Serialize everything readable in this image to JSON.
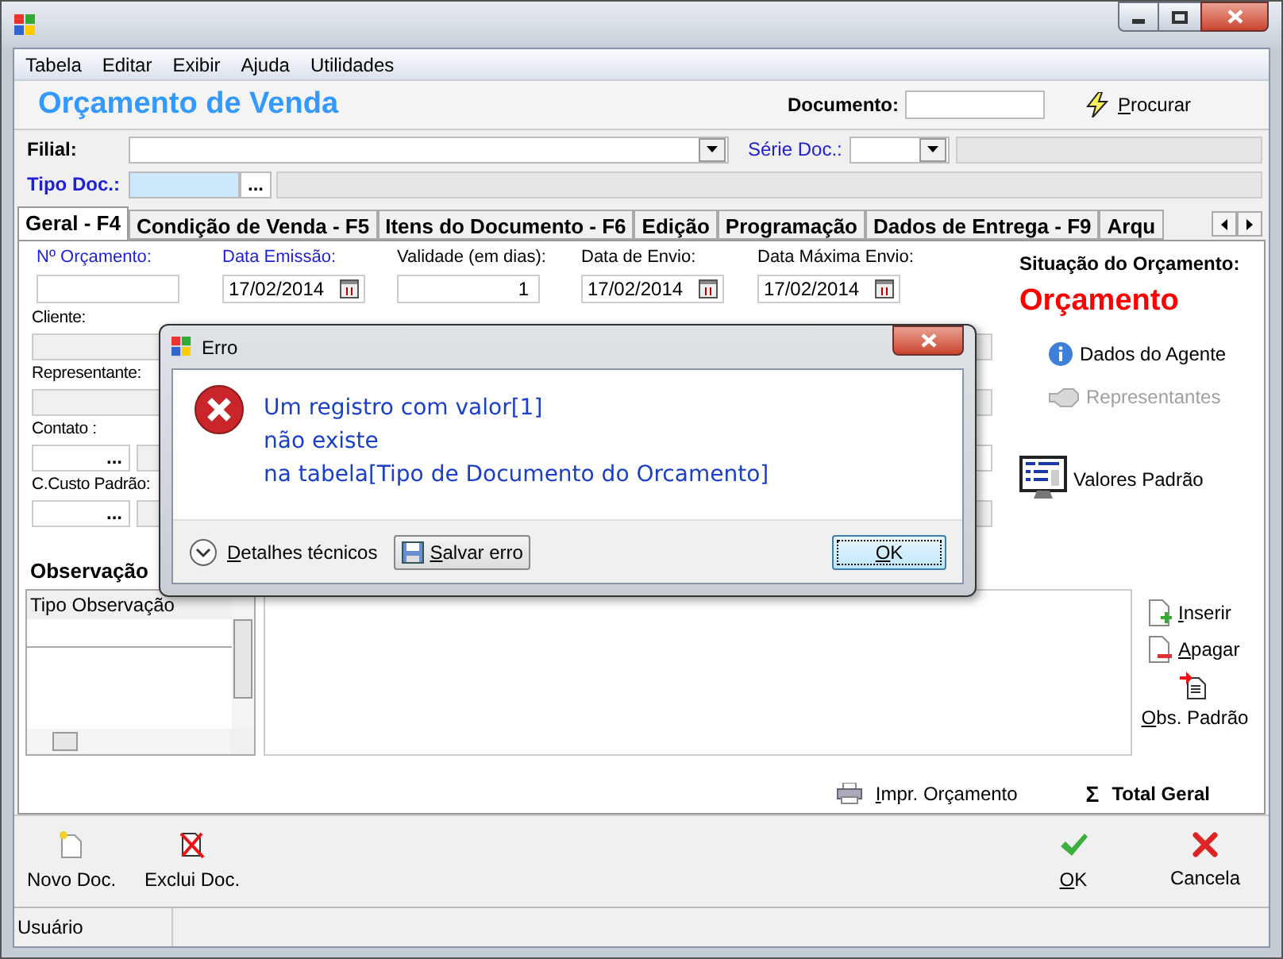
{
  "menu": [
    "Tabela",
    "Editar",
    "Exibir",
    "Ajuda",
    "Utilidades"
  ],
  "header": {
    "title": "Orçamento de Venda",
    "document_label": "Documento:",
    "search_button": "Procurar"
  },
  "filial": {
    "label": "Filial:"
  },
  "serie": {
    "label": "Série Doc.:"
  },
  "tipo_doc": {
    "label": "Tipo Doc.:",
    "lookup": "..."
  },
  "tabs": [
    {
      "label": "Geral - F4",
      "selected": true
    },
    {
      "label": "Condição de Venda - F5",
      "selected": false
    },
    {
      "label": "Itens do Documento - F6",
      "selected": false
    },
    {
      "label": "Edição",
      "selected": false
    },
    {
      "label": "Programação",
      "selected": false
    },
    {
      "label": "Dados de Entrega - F9",
      "selected": false
    },
    {
      "label": "Arqu",
      "selected": false
    }
  ],
  "top_fields": [
    {
      "label": "Nº Orçamento:",
      "required": true,
      "kind": "text"
    },
    {
      "label": "Data Emissão:",
      "required": true,
      "kind": "date",
      "value": "17/02/2014"
    },
    {
      "label": "Validade (em dias):",
      "required": false,
      "kind": "number",
      "value": "1"
    },
    {
      "label": "Data de Envio:",
      "required": false,
      "kind": "date",
      "value": "17/02/2014"
    },
    {
      "label": "Data Máxima Envio:",
      "required": false,
      "kind": "date",
      "value": "17/02/2014"
    }
  ],
  "left_fields": [
    {
      "label": "Cliente:",
      "kind": "plain"
    },
    {
      "label": "Representante:",
      "kind": "plain"
    },
    {
      "label": "Contato :",
      "kind": "lookup",
      "lookup": "..."
    },
    {
      "label": "C.Custo Padrão:",
      "kind": "lookup",
      "lookup": "..."
    }
  ],
  "status": {
    "label": "Situação do Orçamento:",
    "value": "Orçamento"
  },
  "side_actions": [
    {
      "label": "Dados do Agente",
      "kind": "info",
      "disabled": false
    },
    {
      "label": "Representantes",
      "kind": "hand",
      "disabled": true
    },
    {
      "label": "Valores Padrão",
      "kind": "monitor",
      "disabled": false
    }
  ],
  "observacao": {
    "label": "Observação",
    "list_header": "Tipo Observação"
  },
  "obs_actions": [
    {
      "label": "Inserir",
      "kind": "add"
    },
    {
      "label": "Apagar",
      "kind": "delete"
    },
    {
      "label": "Obs. Padrão",
      "kind": "default"
    }
  ],
  "print_button": "Impr. Orçamento",
  "total": {
    "symbol": "Σ",
    "label": "Total Geral"
  },
  "toolbar_left": [
    {
      "label": "Novo Doc.",
      "kind": "new"
    },
    {
      "label": "Exclui Doc.",
      "kind": "delete"
    }
  ],
  "toolbar_right": [
    {
      "label": "OK",
      "kind": "ok"
    },
    {
      "label": "Cancela",
      "kind": "cancel"
    }
  ],
  "status_bar": {
    "user": "Usuário"
  },
  "dialog": {
    "title": "Erro",
    "message_lines": [
      "Um registro com valor[1]",
      "não existe",
      "na tabela[Tipo de Documento do Orcamento]"
    ],
    "details": "Detalhes técnicos",
    "save": "Salvar erro",
    "ok": "OK"
  }
}
